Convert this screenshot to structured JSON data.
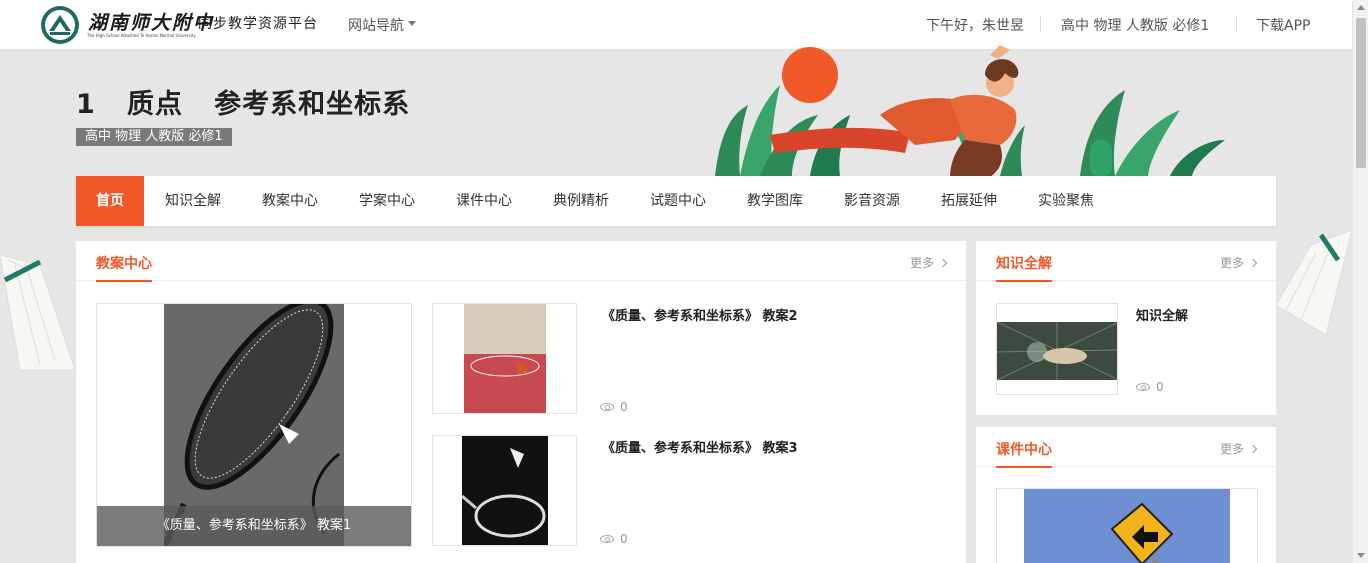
{
  "header": {
    "brand_name": "湖南师大附中",
    "brand_subtitle": "同步教学资源平台",
    "brand_english": "The High School Attached To Hunan Normal University",
    "site_nav_label": "网站导航",
    "greeting": "下午好，朱世昱",
    "course": "高中  物理  人教版  必修1",
    "download_app": "下载APP"
  },
  "hero": {
    "title": "1   质点   参考系和坐标系",
    "tag": "高中  物理  人教版  必修1"
  },
  "tabs": [
    {
      "label": "首页",
      "active": true
    },
    {
      "label": "知识全解"
    },
    {
      "label": "教案中心"
    },
    {
      "label": "学案中心"
    },
    {
      "label": "课件中心"
    },
    {
      "label": "典例精析"
    },
    {
      "label": "试题中心"
    },
    {
      "label": "教学图库"
    },
    {
      "label": "影音资源"
    },
    {
      "label": "拓展延伸"
    },
    {
      "label": "实验聚焦"
    }
  ],
  "lesson_plans": {
    "title": "教案中心",
    "more": "更多",
    "featured_caption": "《质量、参考系和坐标系》 教案1",
    "items": [
      {
        "title": "《质量、参考系和坐标系》 教案2",
        "views": "0"
      },
      {
        "title": "《质量、参考系和坐标系》 教案3",
        "views": "0"
      }
    ]
  },
  "knowledge": {
    "title": "知识全解",
    "more": "更多",
    "item_title": "知识全解",
    "views": "0"
  },
  "courseware": {
    "title": "课件中心",
    "more": "更多"
  },
  "colors": {
    "accent": "#f05a28",
    "tag_bg": "#7a7a7a"
  }
}
